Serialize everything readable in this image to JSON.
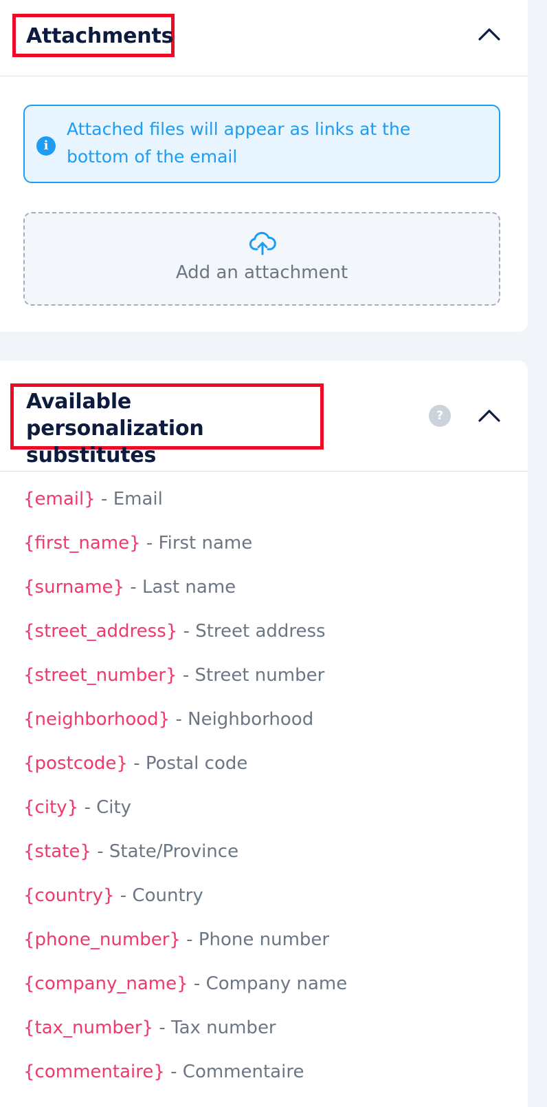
{
  "attachments": {
    "title": "Attachments",
    "info_text": "Attached files will appear as links at the bottom of the email",
    "add_label": "Add an attachment"
  },
  "substitutes": {
    "title": "Available personalization substitutes",
    "help_icon_text": "?",
    "items": [
      {
        "token": "{email}",
        "label": " - Email"
      },
      {
        "token": "{first_name}",
        "label": " - First name"
      },
      {
        "token": "{surname}",
        "label": " - Last name"
      },
      {
        "token": "{street_address}",
        "label": " - Street address"
      },
      {
        "token": "{street_number}",
        "label": " - Street number"
      },
      {
        "token": "{neighborhood}",
        "label": " - Neighborhood"
      },
      {
        "token": "{postcode}",
        "label": " - Postal code"
      },
      {
        "token": "{city}",
        "label": " - City"
      },
      {
        "token": "{state}",
        "label": " - State/Province"
      },
      {
        "token": "{country}",
        "label": " - Country"
      },
      {
        "token": "{phone_number}",
        "label": " - Phone number"
      },
      {
        "token": "{company_name}",
        "label": " - Company name"
      },
      {
        "token": "{tax_number}",
        "label": " - Tax number"
      },
      {
        "token": "{commentaire}",
        "label": " - Commentaire"
      }
    ]
  },
  "icons": {
    "collapse": "chevron-up-icon",
    "info": "info-icon",
    "upload": "cloud-upload-icon",
    "help": "question-icon"
  },
  "colors": {
    "title": "#0d1b3e",
    "highlight_border": "#ee0a24",
    "info_blue": "#1c9cf2",
    "token_pink": "#f0386b",
    "muted_text": "#6b7685",
    "page_bg": "#f1f4f8"
  }
}
